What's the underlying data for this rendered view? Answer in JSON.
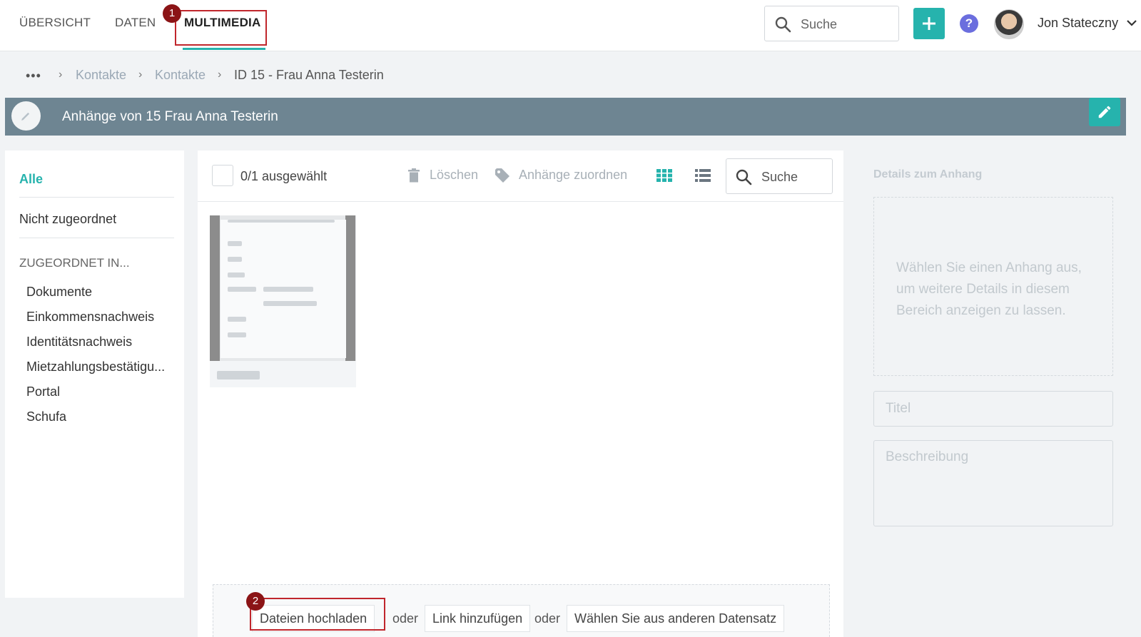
{
  "nav": {
    "tabs": [
      {
        "label": "ÜBERSICHT"
      },
      {
        "label": "DATEN"
      },
      {
        "label": "MULTIMEDIA"
      }
    ],
    "search_placeholder": "Suche",
    "user_name": "Jon Stateczny",
    "help_glyph": "?"
  },
  "annotations": {
    "badge1": "1",
    "badge2": "2",
    "highlight_color": "#c0262c"
  },
  "breadcrumb": {
    "dots": "•••",
    "items": [
      "Kontakte",
      "Kontakte",
      "ID 15 - Frau Anna Testerin"
    ]
  },
  "header": {
    "title": "Anhänge von 15 Frau Anna Testerin"
  },
  "sidebar": {
    "all": "Alle",
    "unassigned": "Nicht zugeordnet",
    "heading": "ZUGEORDNET IN...",
    "categories": [
      "Dokumente",
      "Einkommensnachweis",
      "Identitätsnachweis",
      "Mietzahlungsbestätigu...",
      "Portal",
      "Schufa"
    ]
  },
  "toolbar": {
    "selected": "0/1 ausgewählt",
    "delete": "Löschen",
    "assign": "Anhänge zuordnen",
    "search_placeholder": "Suche"
  },
  "upload": {
    "upload_files": "Dateien hochladen",
    "or1": "oder",
    "add_link": "Link hinzufügen",
    "or2": "oder",
    "choose_other": "Wählen Sie aus anderen Datensatz"
  },
  "details": {
    "title": "Details zum Anhang",
    "empty_message": "Wählen Sie einen Anhang aus, um weitere Details in diesem Bereich anzeigen zu lassen.",
    "title_placeholder": "Titel",
    "description_placeholder": "Beschreibung"
  },
  "colors": {
    "accent": "#26b3ad",
    "header_band": "#6e8592"
  }
}
